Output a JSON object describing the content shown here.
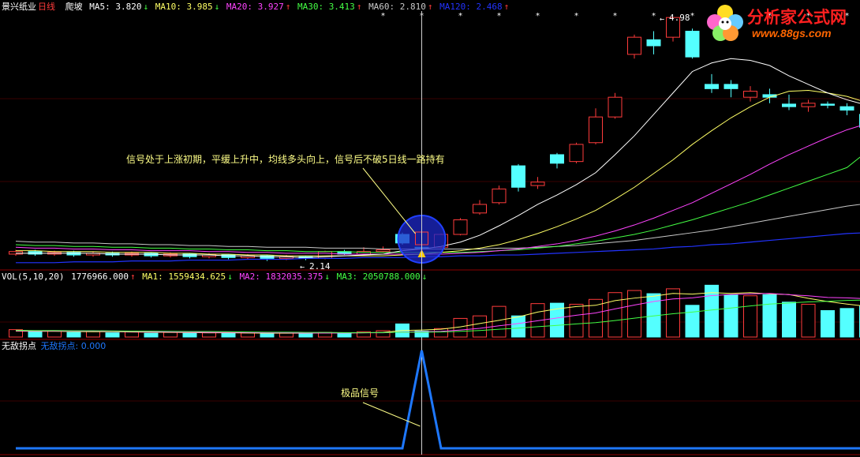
{
  "colors": {
    "up": "#ff3b3b",
    "down": "#54ffff",
    "ma5": "#ffffff",
    "ma10": "#ffff66",
    "ma20": "#ff44ff",
    "ma30": "#44ff44",
    "ma60": "#c8c8c8",
    "ma120": "#2233ff",
    "panel_line": "#8b0000",
    "indicator": "#1e78ff",
    "annotation": "#ffff88",
    "logo_red": "#ff2020",
    "logo_url": "#ff6600"
  },
  "main_header": {
    "stock_name": "景兴纸业",
    "period": "日线",
    "template": "爬坡",
    "ma5": "MA5: 3.820",
    "ma5_arrow": "↓",
    "ma10": "MA10: 3.985",
    "ma10_arrow": "↓",
    "ma20": "MA20: 3.927",
    "ma20_arrow": "↑",
    "ma30": "MA30: 3.413",
    "ma30_arrow": "↑",
    "ma60": "MA60: 2.810",
    "ma60_arrow": "↑",
    "ma120": "MA120: 2.468",
    "ma120_arrow": "↑"
  },
  "price_labels": {
    "high": "4.98",
    "low": "2.14"
  },
  "annotation_main": "信号处于上涨初期，平缓上升中，均线多头向上，信号后不破5日线一路持有",
  "vol_header": {
    "title": "VOL(5,10,20)",
    "vol": "1776966.000",
    "vol_arrow": "↑",
    "ma1": "MA1: 1559434.625",
    "ma1_arrow": "↓",
    "ma2": "MA2: 1832035.375",
    "ma2_arrow": "↓",
    "ma3": "MA3: 2050788.000",
    "ma3_arrow": "↓"
  },
  "ind_header": {
    "title": "无敌拐点",
    "label": "无敌拐点: 0.000"
  },
  "annotation_ind": "极品信号",
  "logo": {
    "title": "分析家公式网",
    "url": "www.88gs.com"
  },
  "chart_data": {
    "type": "candlestick",
    "candles": [
      {
        "o": 2.22,
        "c": 2.25,
        "h": 2.27,
        "l": 2.2
      },
      {
        "o": 2.25,
        "c": 2.22,
        "h": 2.27,
        "l": 2.2
      },
      {
        "o": 2.22,
        "c": 2.24,
        "h": 2.26,
        "l": 2.2
      },
      {
        "o": 2.24,
        "c": 2.21,
        "h": 2.26,
        "l": 2.19
      },
      {
        "o": 2.21,
        "c": 2.23,
        "h": 2.25,
        "l": 2.19
      },
      {
        "o": 2.23,
        "c": 2.21,
        "h": 2.25,
        "l": 2.19
      },
      {
        "o": 2.21,
        "c": 2.23,
        "h": 2.25,
        "l": 2.19
      },
      {
        "o": 2.23,
        "c": 2.2,
        "h": 2.24,
        "l": 2.18
      },
      {
        "o": 2.2,
        "c": 2.22,
        "h": 2.24,
        "l": 2.18
      },
      {
        "o": 2.22,
        "c": 2.19,
        "h": 2.23,
        "l": 2.17
      },
      {
        "o": 2.19,
        "c": 2.21,
        "h": 2.23,
        "l": 2.17
      },
      {
        "o": 2.21,
        "c": 2.18,
        "h": 2.22,
        "l": 2.16
      },
      {
        "o": 2.18,
        "c": 2.2,
        "h": 2.22,
        "l": 2.16
      },
      {
        "o": 2.2,
        "c": 2.17,
        "h": 2.21,
        "l": 2.14
      },
      {
        "o": 2.17,
        "c": 2.19,
        "h": 2.21,
        "l": 2.15
      },
      {
        "o": 2.19,
        "c": 2.17,
        "h": 2.2,
        "l": 2.15
      },
      {
        "o": 2.17,
        "c": 2.25,
        "h": 2.26,
        "l": 2.16
      },
      {
        "o": 2.25,
        "c": 2.22,
        "h": 2.27,
        "l": 2.21
      },
      {
        "o": 2.22,
        "c": 2.25,
        "h": 2.3,
        "l": 2.21
      },
      {
        "o": 2.25,
        "c": 2.27,
        "h": 2.31,
        "l": 2.24
      },
      {
        "o": 2.45,
        "c": 2.35,
        "h": 2.47,
        "l": 2.33
      },
      {
        "o": 2.3,
        "c": 2.28,
        "h": 2.32,
        "l": 2.26
      },
      {
        "o": 2.3,
        "c": 2.45,
        "h": 2.46,
        "l": 2.29
      },
      {
        "o": 2.45,
        "c": 2.62,
        "h": 2.64,
        "l": 2.44
      },
      {
        "o": 2.7,
        "c": 2.8,
        "h": 2.85,
        "l": 2.68
      },
      {
        "o": 2.82,
        "c": 2.98,
        "h": 3.02,
        "l": 2.8
      },
      {
        "o": 3.25,
        "c": 3.0,
        "h": 3.27,
        "l": 2.95
      },
      {
        "o": 3.02,
        "c": 3.06,
        "h": 3.12,
        "l": 2.98
      },
      {
        "o": 3.38,
        "c": 3.28,
        "h": 3.4,
        "l": 3.22
      },
      {
        "o": 3.3,
        "c": 3.5,
        "h": 3.52,
        "l": 3.28
      },
      {
        "o": 3.52,
        "c": 3.82,
        "h": 3.92,
        "l": 3.5
      },
      {
        "o": 3.82,
        "c": 4.05,
        "h": 4.1,
        "l": 3.8
      },
      {
        "o": 4.55,
        "c": 4.75,
        "h": 4.78,
        "l": 4.5
      },
      {
        "o": 4.72,
        "c": 4.65,
        "h": 4.82,
        "l": 4.55
      },
      {
        "o": 4.75,
        "c": 4.98,
        "h": 4.98,
        "l": 4.7
      },
      {
        "o": 4.82,
        "c": 4.52,
        "h": 4.85,
        "l": 4.5
      },
      {
        "o": 4.2,
        "c": 4.15,
        "h": 4.32,
        "l": 4.1
      },
      {
        "o": 4.2,
        "c": 4.15,
        "h": 4.25,
        "l": 4.05
      },
      {
        "o": 4.05,
        "c": 4.12,
        "h": 4.18,
        "l": 4.0
      },
      {
        "o": 4.08,
        "c": 4.05,
        "h": 4.15,
        "l": 3.98
      },
      {
        "o": 3.97,
        "c": 3.94,
        "h": 4.08,
        "l": 3.9
      },
      {
        "o": 3.94,
        "c": 3.98,
        "h": 4.02,
        "l": 3.88
      },
      {
        "o": 3.97,
        "c": 3.96,
        "h": 4.0,
        "l": 3.92
      },
      {
        "o": 3.94,
        "c": 3.9,
        "h": 3.98,
        "l": 3.84
      },
      {
        "o": 3.85,
        "c": 3.7,
        "h": 3.86,
        "l": 3.65
      }
    ],
    "volumes": [
      0.35,
      0.25,
      0.3,
      0.22,
      0.26,
      0.2,
      0.24,
      0.18,
      0.22,
      0.18,
      0.2,
      0.17,
      0.19,
      0.16,
      0.2,
      0.18,
      0.22,
      0.2,
      0.25,
      0.3,
      0.62,
      0.28,
      0.4,
      0.88,
      1.0,
      1.45,
      1.0,
      1.58,
      1.6,
      1.55,
      1.78,
      2.1,
      2.2,
      2.05,
      2.28,
      1.5,
      2.45,
      2.0,
      1.95,
      2.0,
      1.65,
      1.55,
      1.25,
      1.35,
      1.48
    ],
    "ma5": [
      2.23,
      2.23,
      2.23,
      2.23,
      2.23,
      2.22,
      2.22,
      2.22,
      2.21,
      2.21,
      2.21,
      2.2,
      2.2,
      2.19,
      2.19,
      2.18,
      2.19,
      2.2,
      2.21,
      2.22,
      2.26,
      2.28,
      2.31,
      2.36,
      2.44,
      2.55,
      2.67,
      2.8,
      2.91,
      3.03,
      3.17,
      3.38,
      3.6,
      3.85,
      4.1,
      4.35,
      4.45,
      4.5,
      4.48,
      4.42,
      4.3,
      4.2,
      4.1,
      4.02,
      3.96
    ],
    "ma10": [
      2.26,
      2.26,
      2.25,
      2.25,
      2.25,
      2.24,
      2.24,
      2.24,
      2.23,
      2.23,
      2.22,
      2.22,
      2.21,
      2.21,
      2.2,
      2.2,
      2.2,
      2.2,
      2.2,
      2.2,
      2.21,
      2.22,
      2.24,
      2.26,
      2.29,
      2.33,
      2.39,
      2.46,
      2.54,
      2.63,
      2.73,
      2.86,
      3.0,
      3.16,
      3.32,
      3.5,
      3.66,
      3.81,
      3.94,
      4.05,
      4.12,
      4.13,
      4.1,
      4.06,
      3.99
    ],
    "ma20": [
      2.3,
      2.29,
      2.29,
      2.28,
      2.28,
      2.27,
      2.27,
      2.26,
      2.26,
      2.26,
      2.25,
      2.25,
      2.24,
      2.24,
      2.23,
      2.23,
      2.23,
      2.22,
      2.22,
      2.22,
      2.22,
      2.22,
      2.22,
      2.23,
      2.24,
      2.26,
      2.28,
      2.31,
      2.34,
      2.38,
      2.43,
      2.49,
      2.56,
      2.64,
      2.73,
      2.82,
      2.93,
      3.04,
      3.15,
      3.27,
      3.38,
      3.48,
      3.58,
      3.67,
      3.74
    ],
    "ma30": [
      2.33,
      2.32,
      2.32,
      2.31,
      2.31,
      2.3,
      2.3,
      2.29,
      2.29,
      2.28,
      2.28,
      2.27,
      2.27,
      2.26,
      2.26,
      2.25,
      2.25,
      2.25,
      2.24,
      2.24,
      2.24,
      2.24,
      2.24,
      2.24,
      2.25,
      2.26,
      2.27,
      2.29,
      2.31,
      2.34,
      2.37,
      2.41,
      2.45,
      2.5,
      2.56,
      2.62,
      2.69,
      2.76,
      2.83,
      2.91,
      2.99,
      3.07,
      3.15,
      3.23,
      3.41
    ],
    "ma60": [
      2.37,
      2.36,
      2.36,
      2.35,
      2.35,
      2.34,
      2.34,
      2.33,
      2.33,
      2.32,
      2.32,
      2.31,
      2.31,
      2.3,
      2.3,
      2.3,
      2.29,
      2.29,
      2.29,
      2.28,
      2.28,
      2.28,
      2.28,
      2.28,
      2.28,
      2.29,
      2.29,
      2.3,
      2.31,
      2.32,
      2.34,
      2.36,
      2.38,
      2.41,
      2.44,
      2.47,
      2.5,
      2.54,
      2.58,
      2.62,
      2.66,
      2.7,
      2.74,
      2.78,
      2.81
    ],
    "ma120": [
      2.12,
      2.12,
      2.12,
      2.13,
      2.13,
      2.13,
      2.14,
      2.14,
      2.14,
      2.15,
      2.15,
      2.15,
      2.16,
      2.16,
      2.16,
      2.17,
      2.17,
      2.17,
      2.18,
      2.18,
      2.18,
      2.19,
      2.19,
      2.2,
      2.2,
      2.21,
      2.21,
      2.22,
      2.23,
      2.24,
      2.25,
      2.26,
      2.27,
      2.28,
      2.3,
      2.31,
      2.33,
      2.34,
      2.36,
      2.38,
      2.4,
      2.42,
      2.44,
      2.46,
      2.47
    ],
    "vma5": [
      0.28,
      0.27,
      0.27,
      0.26,
      0.25,
      0.25,
      0.24,
      0.23,
      0.22,
      0.21,
      0.2,
      0.2,
      0.19,
      0.18,
      0.18,
      0.18,
      0.19,
      0.19,
      0.2,
      0.22,
      0.31,
      0.33,
      0.37,
      0.48,
      0.64,
      0.79,
      0.95,
      1.18,
      1.33,
      1.44,
      1.5,
      1.72,
      1.84,
      1.93,
      2.06,
      2.03,
      2.1,
      2.06,
      2.1,
      2.04,
      2.01,
      1.83,
      1.68,
      1.56,
      1.45
    ],
    "vma10": [
      0.3,
      0.29,
      0.29,
      0.28,
      0.28,
      0.27,
      0.26,
      0.25,
      0.24,
      0.23,
      0.22,
      0.22,
      0.21,
      0.2,
      0.2,
      0.19,
      0.19,
      0.19,
      0.2,
      0.2,
      0.24,
      0.25,
      0.27,
      0.33,
      0.41,
      0.53,
      0.64,
      0.77,
      0.9,
      1.03,
      1.14,
      1.33,
      1.51,
      1.68,
      1.8,
      1.85,
      1.96,
      2.01,
      2.04,
      2.06,
      2.0,
      1.95,
      1.87,
      1.85,
      1.81
    ],
    "vma20": [
      0.32,
      0.31,
      0.31,
      0.3,
      0.3,
      0.29,
      0.28,
      0.28,
      0.27,
      0.26,
      0.26,
      0.25,
      0.24,
      0.23,
      0.23,
      0.22,
      0.22,
      0.21,
      0.21,
      0.21,
      0.23,
      0.23,
      0.24,
      0.27,
      0.31,
      0.37,
      0.42,
      0.49,
      0.55,
      0.62,
      0.68,
      0.78,
      0.89,
      1.0,
      1.1,
      1.18,
      1.28,
      1.37,
      1.47,
      1.56,
      1.61,
      1.66,
      1.69,
      1.73,
      1.75
    ],
    "indicator": [
      0,
      0,
      0,
      0,
      0,
      0,
      0,
      0,
      0,
      0,
      0,
      0,
      0,
      0,
      0,
      0,
      0,
      0,
      0,
      0,
      0,
      1,
      0,
      0,
      0,
      0,
      0,
      0,
      0,
      0,
      0,
      0,
      0,
      0,
      0,
      0,
      0,
      0,
      0,
      0,
      0,
      0,
      0,
      0,
      0
    ],
    "signal_index": 21
  }
}
